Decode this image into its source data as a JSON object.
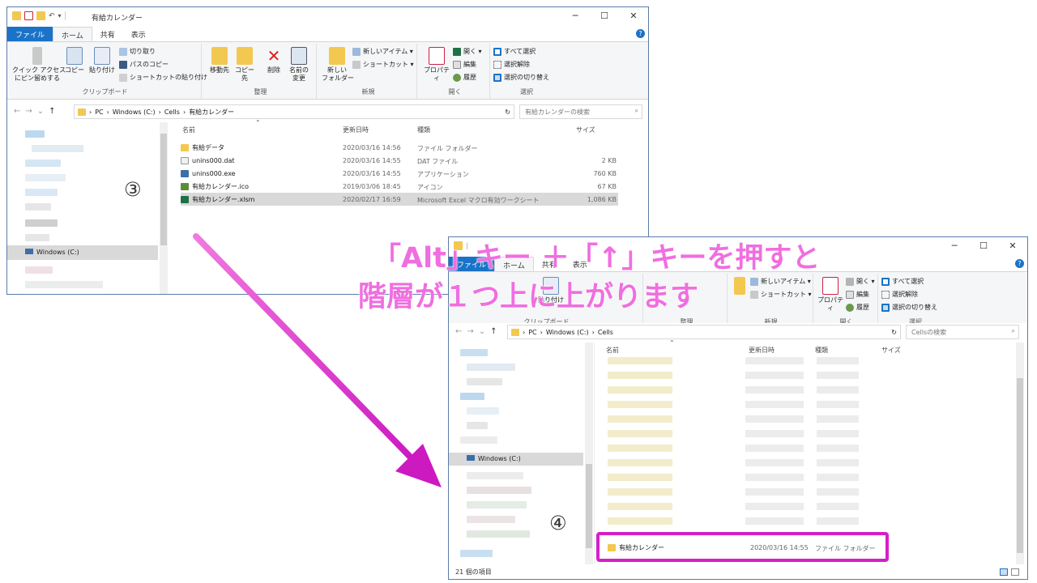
{
  "window1": {
    "title": "有給カレンダー",
    "tabs": {
      "file": "ファイル",
      "home": "ホーム",
      "share": "共有",
      "view": "表示"
    },
    "ribbon": {
      "pin": "クイック アクセス\nにピン留めする",
      "copy": "コピー",
      "paste": "貼り付け",
      "cut": "切り取り",
      "copy_path": "パスのコピー",
      "paste_shortcut": "ショートカットの貼り付け",
      "clipboard_group": "クリップボード",
      "move_to": "移動先",
      "copy_to": "コピー先",
      "delete": "削除",
      "rename": "名前の\n変更",
      "organize_group": "整理",
      "new_folder": "新しい\nフォルダー",
      "new_item": "新しいアイテム ▾",
      "easy_access": "ショートカット ▾",
      "new_group": "新規",
      "properties": "プロパティ",
      "open": "開く ▾",
      "edit": "編集",
      "history": "履歴",
      "open_group": "開く",
      "select_all": "すべて選択",
      "select_none": "選択解除",
      "invert_selection": "選択の切り替え",
      "select_group": "選択"
    },
    "address": {
      "pc": "PC",
      "drive": "Windows (C:)",
      "folder1": "Cells",
      "folder2": "有給カレンダー",
      "search_placeholder": "有給カレンダーの検索"
    },
    "columns": {
      "name": "名前",
      "date": "更新日時",
      "type": "種類",
      "size": "サイズ"
    },
    "nav_drive": "Windows (C:)",
    "rows": [
      {
        "name": "有給データ",
        "date": "2020/03/16 14:56",
        "type": "ファイル フォルダー",
        "size": ""
      },
      {
        "name": "unins000.dat",
        "date": "2020/03/16 14:55",
        "type": "DAT ファイル",
        "size": "2 KB"
      },
      {
        "name": "unins000.exe",
        "date": "2020/03/16 14:55",
        "type": "アプリケーション",
        "size": "760 KB"
      },
      {
        "name": "有給カレンダー.ico",
        "date": "2019/03/06 18:45",
        "type": "アイコン",
        "size": "67 KB"
      },
      {
        "name": "有給カレンダー.xlsm",
        "date": "2020/02/17 16:59",
        "type": "Microsoft Excel マクロ有効ワークシート",
        "size": "1,086 KB"
      }
    ]
  },
  "window2": {
    "tabs": {
      "file": "ファイル",
      "home": "ホーム",
      "share": "共有",
      "view": "表示"
    },
    "ribbon": {
      "clipboard_group": "クリップボード",
      "organize_group": "整理",
      "new_group": "新規",
      "open_group": "開く",
      "select_group": "選択",
      "paste": "貼り付け",
      "new_item": "新しいアイテム ▾",
      "easy_access": "ショートカット ▾",
      "properties": "プロパティ",
      "open": "開く ▾",
      "edit": "編集",
      "history": "履歴",
      "select_all": "すべて選択",
      "select_none": "選択解除",
      "invert_selection": "選択の切り替え"
    },
    "address": {
      "pc": "PC",
      "drive": "Windows (C:)",
      "folder1": "Cells",
      "search_placeholder": "Cellsの検索"
    },
    "columns": {
      "name": "名前",
      "date": "更新日時",
      "type": "種類",
      "size": "サイズ"
    },
    "nav_drive": "Windows (C:)",
    "highlight_row": {
      "name": "有給カレンダー",
      "date": "2020/03/16 14:55",
      "type": "ファイル フォルダー"
    },
    "status": "21 個の項目"
  },
  "annotations": {
    "step3": "③",
    "step4": "④",
    "caption_line1": "「Alt」キー ＋「↑」キーを押すと",
    "caption_line2": "階層が１つ上に上がります"
  },
  "colors": {
    "accent": "#1a73c8",
    "highlight": "#d61fc8",
    "caption": "#f06ee0",
    "folder": "#f3c850"
  }
}
